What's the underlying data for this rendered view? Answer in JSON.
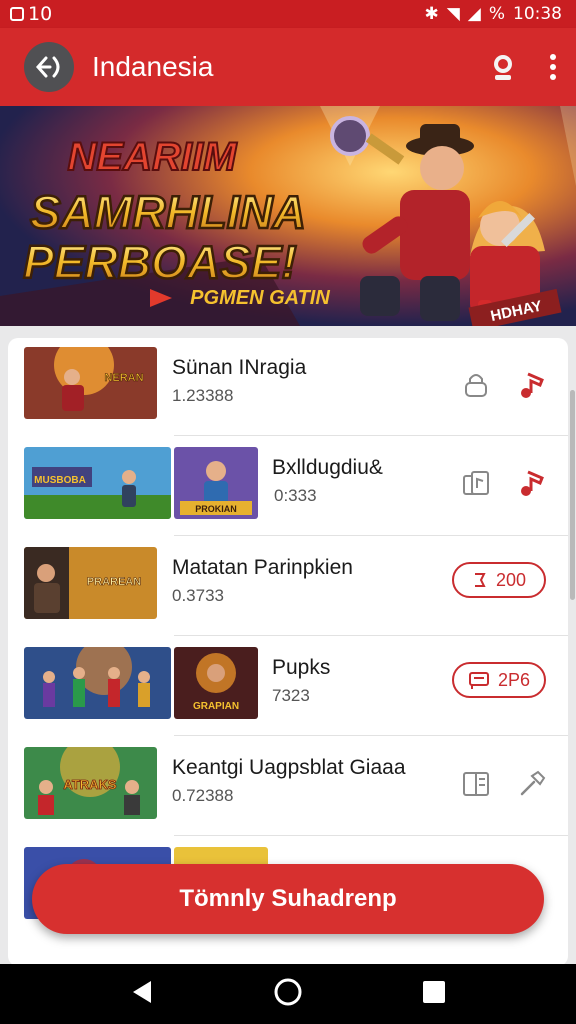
{
  "status_bar": {
    "left_text": "10",
    "time": "10:38"
  },
  "app_bar": {
    "title": "Indanesia"
  },
  "banner": {
    "line1": "NEARIIM",
    "line2": "SAMRHLINA",
    "line3": "PERBOASE!",
    "tagline": "PGMEN GATIN",
    "badge": "HDHAY",
    "colors": {
      "sky": "#2a2a5c",
      "burst": "#ffb13a",
      "text": "#f5c12f"
    }
  },
  "games": [
    {
      "title": "Sünan INragia",
      "subtitle": "1.23388",
      "thumb_text": "NERAN",
      "action": "icons"
    },
    {
      "title": "Bxlldugdiu&",
      "subtitle": "0:333",
      "thumb_text": "MUSBOBA",
      "thumb2_text": "PROKIAN",
      "action": "icons"
    },
    {
      "title": "Matatan Parinpkien",
      "subtitle": "0.3733",
      "thumb_text": "PRAREAN",
      "action": "pill",
      "pill_label": "200"
    },
    {
      "title": "Pupks",
      "subtitle": "7323",
      "thumb_text": "GRAPIAN",
      "action": "pill",
      "pill_label": "2P6"
    },
    {
      "title": "Keantgi Uagpsblat Giaaa",
      "subtitle": "0.72388",
      "thumb_text": "ATRAKS",
      "action": "icons"
    }
  ],
  "fab": {
    "label": "Tömnly Suhadrenp"
  },
  "colors": {
    "primary": "#d42a2b",
    "status": "#c91e22",
    "accent": "#c92c2f"
  }
}
